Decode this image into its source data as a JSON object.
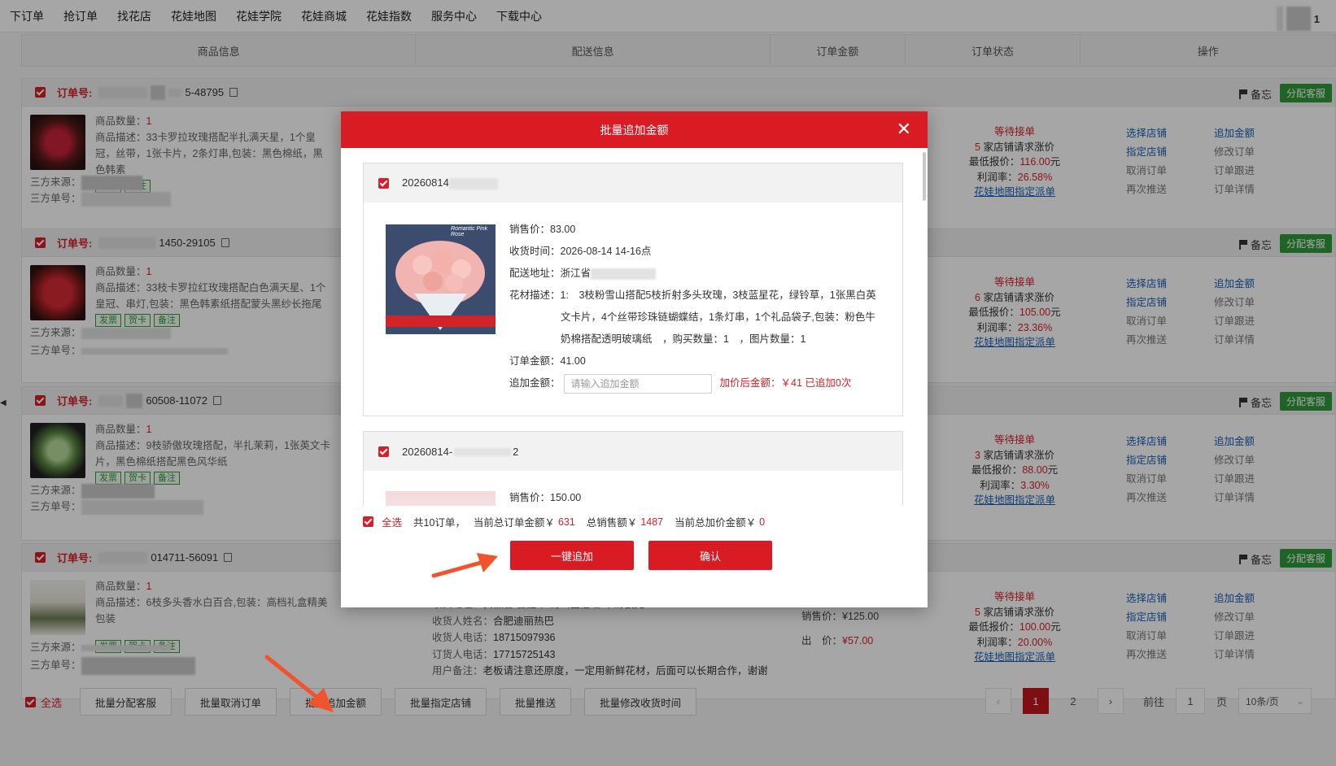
{
  "nav": {
    "items": [
      "下订单",
      "抢订单",
      "找花店",
      "花娃地图",
      "花娃学院",
      "花娃商城",
      "花娃指数",
      "服务中心",
      "下载中心"
    ],
    "user_suffix": "1"
  },
  "table": {
    "headers": [
      "商品信息",
      "配送信息",
      "订单金额",
      "订单状态",
      "操作"
    ]
  },
  "order_common": {
    "label": "订单号:",
    "remark": "备忘",
    "assign": "分配客服",
    "qty_label": "商品数量：",
    "desc_label": "商品描述：",
    "src_label": "三方来源：",
    "srcno_label": "三方单号：",
    "tags": [
      "发票",
      "贺卡",
      "备注"
    ],
    "ops_left": [
      "选择店铺",
      "指定店铺",
      "取消订单",
      "再次推送"
    ],
    "ops_right": [
      "追加金额",
      "修改订单",
      "订单跟进",
      "订单详情"
    ],
    "status": "等待接单",
    "stores_suffix": "家店铺请求涨价",
    "min_label": "最低报价：",
    "yuan": "元",
    "profit_label": "利润率：",
    "map_link": "花娃地图指定派单"
  },
  "orders": [
    {
      "num": "5-48795",
      "qty": "1",
      "desc": "33卡罗拉玫瑰搭配半扎满天星，1个皇冠，丝带，1张卡片，2条灯串,包装：黑色棉纸，黑色韩素",
      "tags": [
        "发票",
        "备注"
      ],
      "stores": "5",
      "min": "116.00",
      "profit": "26.58%"
    },
    {
      "num": "1450-29105",
      "qty": "1",
      "desc": "33枝卡罗拉红玫瑰搭配白色满天星、1个皇冠、串灯,包装：黑色韩素纸搭配蒙头黑纱长拖尾",
      "tags": [
        "发票",
        "贺卡",
        "备注"
      ],
      "stores": "6",
      "min": "105.00",
      "profit": "23.36%"
    },
    {
      "num": "60508-11072",
      "qty": "1",
      "desc": "9枝骄傲玫瑰搭配，半扎茉莉，1张英文卡片，黑色棉纸搭配黑色风华纸",
      "tags": [
        "发票",
        "贺卡",
        "备注"
      ],
      "stores": "3",
      "min": "88.00",
      "profit": "3.30%"
    },
    {
      "num": "014711-56091",
      "qty": "1",
      "desc": "6枝多头香水白百合,包装：高档礼盒精美包装",
      "tags": [
        "发票",
        "贺卡",
        "备注"
      ],
      "stores": "5",
      "min": "100.00",
      "profit": "20.00%"
    }
  ],
  "delivery4": {
    "addr_label": "收货地址：",
    "addr": "安徽省 合肥市 蜀山区信旺·华府骏苑",
    "name_label": "收货人姓名：",
    "name": "合肥迪丽热巴",
    "phone_label": "收货人电话：",
    "phone": "18715097936",
    "buyer_label": "订货人电话：",
    "buyer": "17715725143",
    "note_label": "用户备注：",
    "note": "老板请注意还原度，一定用新鲜花材，后面可以长期合作，谢谢"
  },
  "amount4": {
    "sale_label": "销售价：",
    "sale": "¥125.00",
    "out_label": "出　价：",
    "out": "¥57.00"
  },
  "footer": {
    "select_all": "全选",
    "buttons": [
      "批量分配客服",
      "批量取消订单",
      "批量追加金额",
      "批量指定店铺",
      "批量推送",
      "批量修改收货时间"
    ],
    "pages": [
      "1",
      "2"
    ],
    "goto": "前往",
    "page_val": "1",
    "page_unit": "页",
    "per_page": "10条/页"
  },
  "modal": {
    "title": "批量追加金额",
    "card1": {
      "order": "20260814",
      "sale_label": "销售价：",
      "sale": "83.00",
      "time_label": "收货时间：",
      "time": "2026-08-14 14-16点",
      "addr_label": "配送地址：",
      "addr": "浙江省",
      "flower_label": "花材描述：",
      "flower1": "1:　3枝粉雪山搭配5枝折射多头玫瑰，3枝蓝星花，绿铃草，1张黑白英",
      "flower2": "文卡片，4个丝带珍珠链蝴蝶结，1条灯串，1个礼品袋子,包装：粉色牛",
      "flower3": "奶棉搭配透明玻璃纸　，购买数量：1　，图片数量：1",
      "amt_label": "订单金额：",
      "amt": "41.00",
      "add_label": "追加金额：",
      "add_placeholder": "请输入追加金额",
      "after": "加价后金额：￥41 已追加0次",
      "img_text": "Romantic Pink Rose"
    },
    "card2": {
      "order": "20260814-",
      "order_tail": "2",
      "sale_label": "销售价：",
      "sale": "150.00"
    },
    "summary": {
      "select_all": "全选",
      "count": "共10订单，",
      "cur_label": "当前总订单金额￥",
      "cur": "631",
      "sale_label": "总销售额￥",
      "sale": "1487",
      "add_label": "当前总加价金额￥",
      "add": "0"
    },
    "btn_one": "一键追加",
    "btn_ok": "确认"
  }
}
